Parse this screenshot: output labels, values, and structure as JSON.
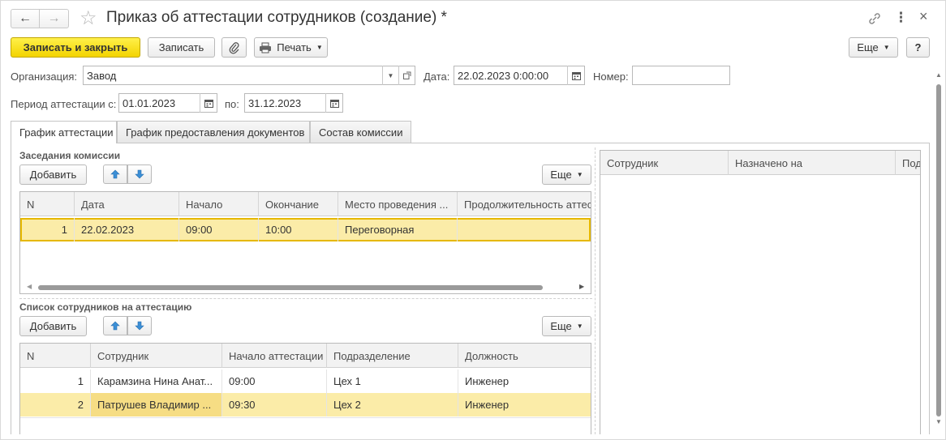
{
  "window": {
    "title": "Приказ об аттестации сотрудников (создание) *",
    "nav_back": "←",
    "nav_forward": "→",
    "star": "☆",
    "link_icon": "🔗",
    "more_icon": "⋮",
    "close_icon": "×"
  },
  "toolbar": {
    "save_close": "Записать и закрыть",
    "save": "Записать",
    "attach": "📎",
    "print": "Печать",
    "more": "Еще",
    "help": "?"
  },
  "form": {
    "org_label": "Организация:",
    "org_value": "Завод",
    "date_label": "Дата:",
    "date_value": "22.02.2023  0:00:00",
    "number_label": "Номер:",
    "number_value": "",
    "period_label": "Период аттестации с:",
    "period_from": "01.01.2023",
    "period_to_label": "по:",
    "period_to": "31.12.2023"
  },
  "tabs": [
    {
      "label": "График аттестации"
    },
    {
      "label": "График предоставления документов"
    },
    {
      "label": "Состав комиссии"
    }
  ],
  "sessions": {
    "title": "Заседания комиссии",
    "add": "Добавить",
    "more": "Еще",
    "columns": [
      "N",
      "Дата",
      "Начало",
      "Окончание",
      "Место проведения ...",
      "Продолжительность аттест"
    ],
    "rows": [
      {
        "n": "1",
        "date": "22.02.2023",
        "start": "09:00",
        "end": "10:00",
        "place": "Переговорная",
        "duration": ""
      }
    ]
  },
  "employees": {
    "title": "Список сотрудников на аттестацию",
    "add": "Добавить",
    "more": "Еще",
    "columns": [
      "N",
      "Сотрудник",
      "Начало аттестации",
      "Подразделение",
      "Должность"
    ],
    "rows": [
      {
        "n": "1",
        "employee": "Карамзина Нина Анат...",
        "start": "09:00",
        "dept": "Цех 1",
        "position": "Инженер"
      },
      {
        "n": "2",
        "employee": "Патрушев Владимир ...",
        "start": "09:30",
        "dept": "Цех 2",
        "position": "Инженер"
      }
    ]
  },
  "assignments": {
    "columns": [
      "Сотрудник",
      "Назначено на",
      "Под"
    ]
  },
  "colors": {
    "primary_button": "#f3d400",
    "selected_row": "#fbeca8",
    "accent_arrow": "#3b8fd6"
  }
}
